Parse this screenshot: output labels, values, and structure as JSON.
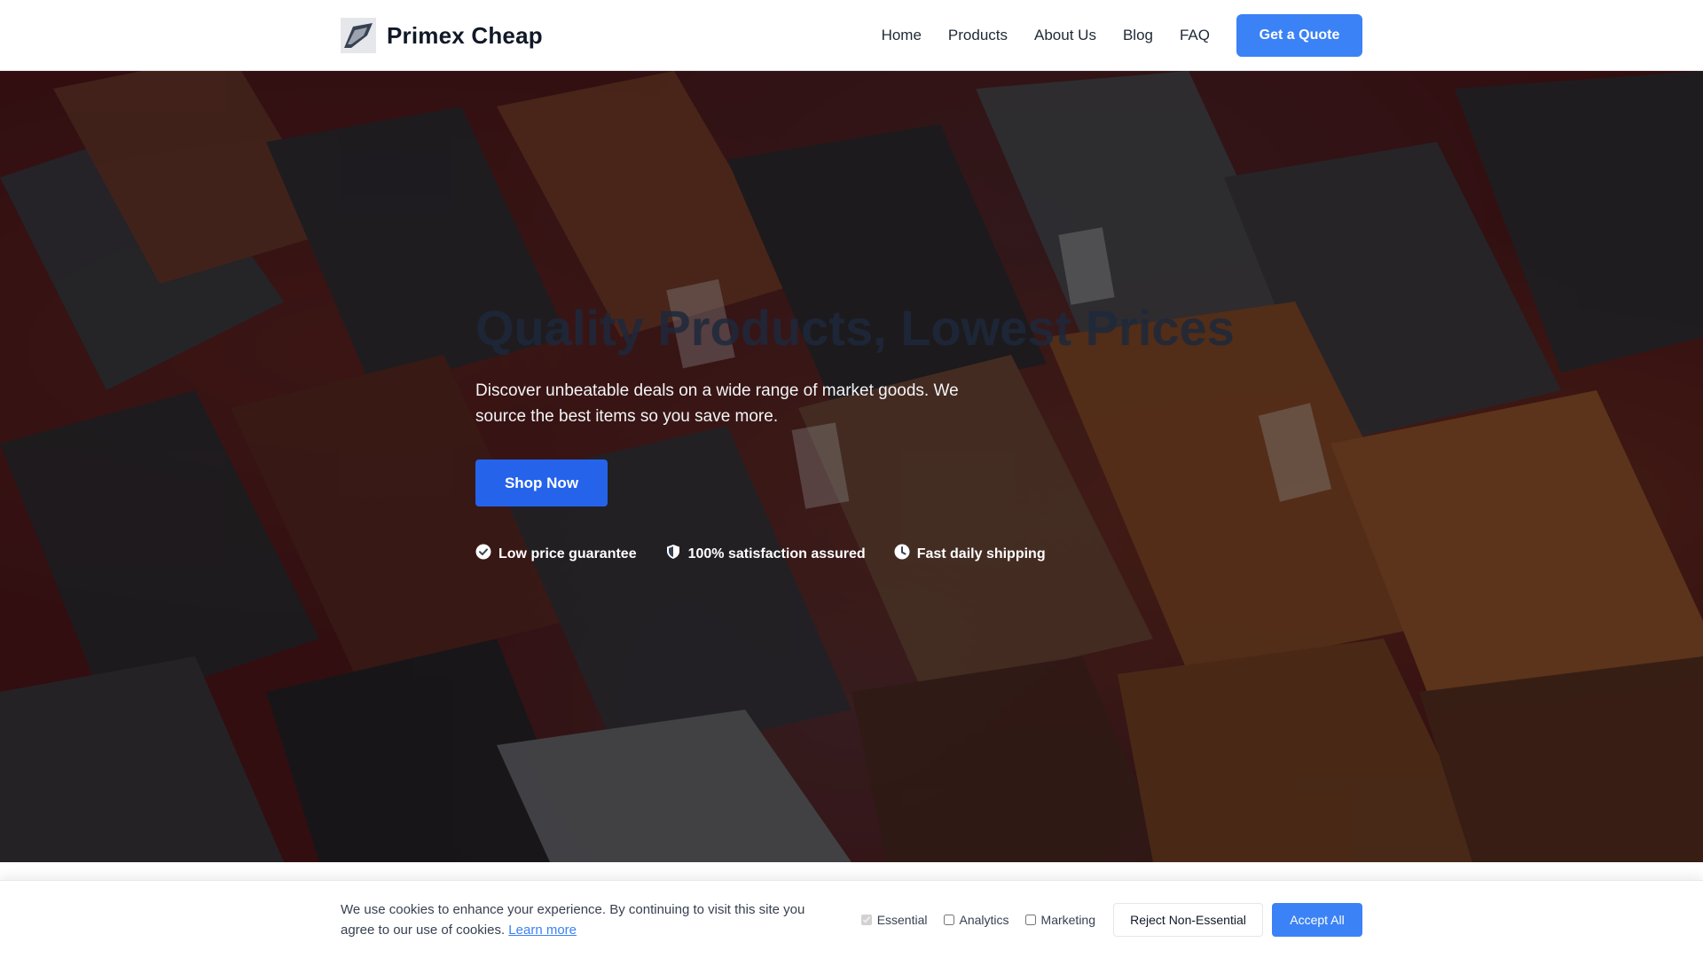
{
  "header": {
    "brand_name": "Primex Cheap",
    "nav": [
      "Home",
      "Products",
      "About Us",
      "Blog",
      "FAQ"
    ],
    "cta_label": "Get a Quote"
  },
  "hero": {
    "title": "Quality Products, Lowest Prices",
    "subtitle": "Discover unbeatable deals on a wide range of market goods. We source the best items so you save more.",
    "button_label": "Shop Now",
    "features": [
      {
        "icon": "check-circle-icon",
        "label": "Low price guarantee"
      },
      {
        "icon": "shield-icon",
        "label": "100% satisfaction assured"
      },
      {
        "icon": "clock-icon",
        "label": "Fast daily shipping"
      }
    ]
  },
  "cookie_banner": {
    "text": "We use cookies to enhance your experience. By continuing to visit this site you agree to our use of cookies.",
    "learn_more": "Learn more",
    "options": [
      {
        "label": "Essential",
        "checked": true,
        "disabled": true
      },
      {
        "label": "Analytics",
        "checked": false,
        "disabled": false
      },
      {
        "label": "Marketing",
        "checked": false,
        "disabled": false
      }
    ],
    "reject_label": "Reject Non-Essential",
    "accept_label": "Accept All"
  },
  "colors": {
    "primary": "#3b82f6",
    "shop_button": "#2563eb",
    "hero_title": "#1e293b"
  }
}
